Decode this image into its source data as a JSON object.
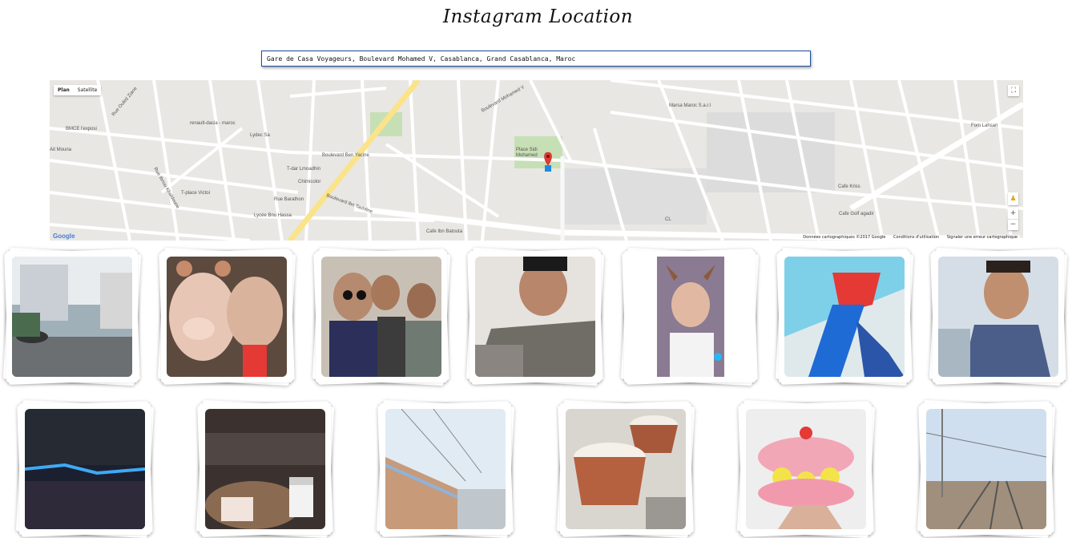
{
  "app": {
    "title": "Instagram Location"
  },
  "search": {
    "value": "Gare de Casa Voyageurs, Boulevard Mohamed V, Casablanca, Grand Casablanca, Maroc"
  },
  "map": {
    "type_controls": [
      "Plan",
      "Satellite"
    ],
    "google_logo": "Google",
    "attribution": {
      "data": "Données cartographiques ©2017 Google",
      "terms": "Conditions d'utilisation",
      "report": "Signaler une erreur cartographique"
    },
    "labels": {
      "place_sidi": "Place Sidi Mohamed",
      "marsa": "Marsa Maroc S.a.r.l",
      "renault": "renault-dacia - maroc",
      "lydec": "Lydec Sa",
      "bd_ben_yacine": "Boulevard Ben Yacine",
      "bd_ibn_tachfine": "Boulevard Ibn Tachfine",
      "bd_mohamed_v": "Boulevard Mohamed V",
      "rue_ouled_ziane": "Rue Ouled Ziane",
      "rue_ibnou_khaldoune": "Rue Ibnou Khaldoune",
      "lycee": "Lycée Bnu Hassa",
      "chimicolor": "Chimicolor",
      "fom_lahsan": "Fom Lahsan",
      "cafe_golf": "Cafe Golf agadir",
      "rue_barathon": "Rue Barathon",
      "cl": "CL",
      "ait_mouna": "Ait Mouna",
      "bmce": "BMCE l'exposi",
      "tdar": "T-dar Lmoadhin",
      "place_victoire": "T-place Victoi",
      "cafe_kriss": "Cafe Kriss",
      "cafe_ibn_batouta": "Cafe Ibn Batouta"
    },
    "zoom": [
      "+",
      "−"
    ]
  },
  "photos": [
    "street-photo",
    "selfie-filter-photo",
    "group-selfie-photo",
    "portrait-photo",
    "dog-filter-photo",
    "blue-dress-photo",
    "selfie-photo",
    "night-city-photo",
    "cafe-photo",
    "train-photo",
    "pudding-photo",
    "macaron-photo",
    "railway-photo"
  ]
}
